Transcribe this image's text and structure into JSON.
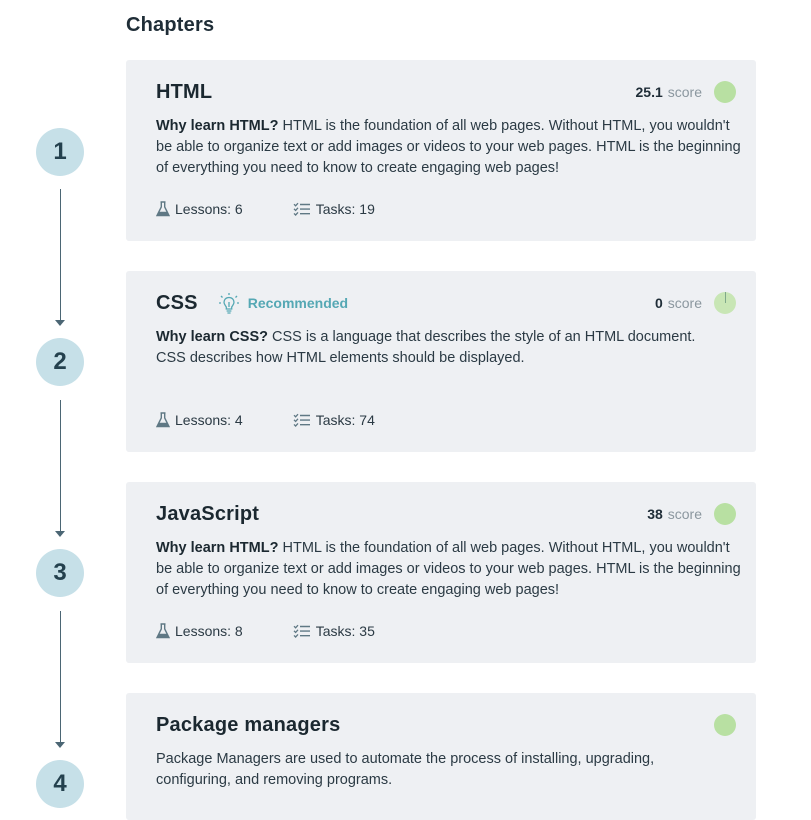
{
  "heading": "Chapters",
  "steps": [
    "1",
    "2",
    "3",
    "4"
  ],
  "chapters": [
    {
      "title": "HTML",
      "score_value": "25.1",
      "score_label": "score",
      "desc_lead": "Why learn HTML?",
      "desc": "HTML is the foundation of all web pages. Without HTML, you wouldn't be able to organize text or add images or videos to your web pages. HTML is the beginning of everything you need to know to create engaging web pages!",
      "lessons": "Lessons: 6",
      "tasks": "Tasks: 19"
    },
    {
      "title": "CSS",
      "badge": "Recommended",
      "score_value": "0",
      "score_label": "score",
      "desc_lead": "Why learn CSS?",
      "desc": "CSS is a language that describes the style of an HTML document. CSS describes how HTML elements should be displayed.",
      "lessons": "Lessons: 4",
      "tasks": "Tasks: 74"
    },
    {
      "title": "JavaScript",
      "score_value": "38",
      "score_label": "score",
      "desc_lead": "Why learn HTML?",
      "desc": "HTML is the foundation of all web pages. Without HTML, you wouldn't be able to organize text or add images or videos to your web pages. HTML is the beginning of everything you need to know to create engaging web pages!",
      "lessons": "Lessons: 8",
      "tasks": "Tasks: 35"
    },
    {
      "title": "Package managers",
      "desc": "Package Managers are used to automate the process of installing, upgrading, configuring, and removing programs."
    }
  ],
  "icons": {
    "lessons": "flask-icon",
    "tasks": "checklist-icon",
    "recommended": "lightbulb-icon",
    "score": "progress-circle-icon"
  },
  "colors": {
    "card_bg": "#eef0f3",
    "step_circle": "#c6e0e8",
    "score_dot": "#b8e0a2",
    "recommended": "#55a8b4"
  }
}
